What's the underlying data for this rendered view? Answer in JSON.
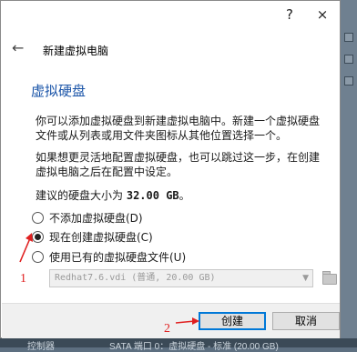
{
  "title_bar": {
    "help_label": "?",
    "close_label": "×"
  },
  "wizard": {
    "title": "新建虚拟电脑",
    "section_title": "虚拟硬盘",
    "paragraph1": "你可以添加虚拟硬盘到新建虚拟电脑中。新建一个虚拟硬盘文件或从列表或用文件夹图标从其他位置选择一个。",
    "paragraph2": "如果想更灵活地配置虚拟硬盘，也可以跳过这一步，在创建虚拟电脑之后在配置中设定。",
    "recommend_prefix": "建议的硬盘大小为",
    "recommend_size": "32.00 GB",
    "recommend_suffix": "。"
  },
  "options": [
    {
      "label": "不添加虚拟硬盘(D)",
      "checked": false
    },
    {
      "label": "现在创建虚拟硬盘(C)",
      "checked": true
    },
    {
      "label": "使用已有的虚拟硬盘文件(U)",
      "checked": false
    }
  ],
  "existing_file": {
    "value": "Redhat7.6.vdi (普通, 20.00 GB)"
  },
  "buttons": {
    "create": "创建",
    "cancel": "取消"
  },
  "annotations": {
    "one": "1",
    "two": "2"
  },
  "background_text": {
    "left": "控制器",
    "right": "SATA 端口 0：虚拟硬盘 - 标准 (20.00 GB)"
  },
  "colors": {
    "accent": "#0078d7",
    "title_blue": "#1a54a8",
    "annotation_red": "#e02020"
  }
}
